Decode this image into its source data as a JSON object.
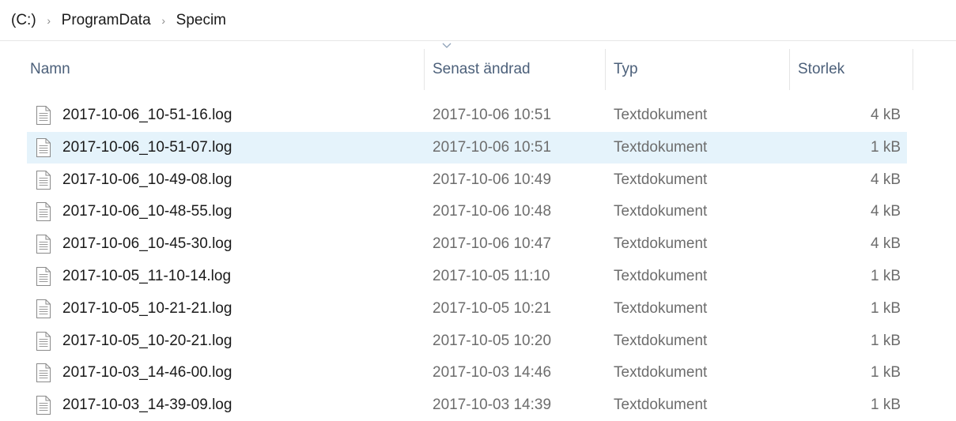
{
  "breadcrumb": {
    "items": [
      "(C:)",
      "ProgramData",
      "Specim"
    ],
    "separator": "›"
  },
  "columns": {
    "name": "Namn",
    "date": "Senast ändrad",
    "type": "Typ",
    "size": "Storlek"
  },
  "sort": {
    "column": "Senast ändrad",
    "direction": "descending",
    "icon": "chevron-down-icon"
  },
  "files": [
    {
      "name": "2017-10-06_10-51-16.log",
      "date": "2017-10-06 10:51",
      "type": "Textdokument",
      "size": "4 kB",
      "selected": false
    },
    {
      "name": "2017-10-06_10-51-07.log",
      "date": "2017-10-06 10:51",
      "type": "Textdokument",
      "size": "1 kB",
      "selected": true
    },
    {
      "name": "2017-10-06_10-49-08.log",
      "date": "2017-10-06 10:49",
      "type": "Textdokument",
      "size": "4 kB",
      "selected": false
    },
    {
      "name": "2017-10-06_10-48-55.log",
      "date": "2017-10-06 10:48",
      "type": "Textdokument",
      "size": "4 kB",
      "selected": false
    },
    {
      "name": "2017-10-06_10-45-30.log",
      "date": "2017-10-06 10:47",
      "type": "Textdokument",
      "size": "4 kB",
      "selected": false
    },
    {
      "name": "2017-10-05_11-10-14.log",
      "date": "2017-10-05 11:10",
      "type": "Textdokument",
      "size": "1 kB",
      "selected": false
    },
    {
      "name": "2017-10-05_10-21-21.log",
      "date": "2017-10-05 10:21",
      "type": "Textdokument",
      "size": "1 kB",
      "selected": false
    },
    {
      "name": "2017-10-05_10-20-21.log",
      "date": "2017-10-05 10:20",
      "type": "Textdokument",
      "size": "1 kB",
      "selected": false
    },
    {
      "name": "2017-10-03_14-46-00.log",
      "date": "2017-10-03 14:46",
      "type": "Textdokument",
      "size": "1 kB",
      "selected": false
    },
    {
      "name": "2017-10-03_14-39-09.log",
      "date": "2017-10-03 14:39",
      "type": "Textdokument",
      "size": "1 kB",
      "selected": false
    }
  ],
  "colors": {
    "selection": "#e5f3fb",
    "header_text": "#4c607a",
    "secondary_text": "#6d6d6d"
  },
  "file_icon": "text-document-icon"
}
